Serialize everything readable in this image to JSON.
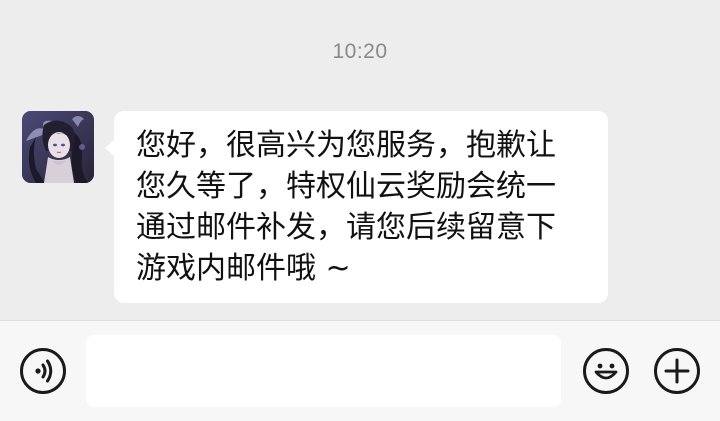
{
  "chat": {
    "timestamp": "10:20",
    "messages": [
      {
        "sender": "other",
        "avatar_icon": "anime-character-avatar",
        "text": "您好，很高兴为您服务，抱歉让您久等了，特权仙云奖励会统一通过邮件补发，请您后续留意下游戏内邮件哦 ~"
      }
    ]
  },
  "input_bar": {
    "voice_icon": "voice-icon",
    "input_value": "",
    "emoji_icon": "emoji-icon",
    "plus_icon": "plus-icon"
  },
  "colors": {
    "background": "#ededed",
    "bubble": "#ffffff",
    "input_bar": "#f7f7f7",
    "timestamp": "#8a8a8a",
    "icon": "#1a1a1a"
  }
}
